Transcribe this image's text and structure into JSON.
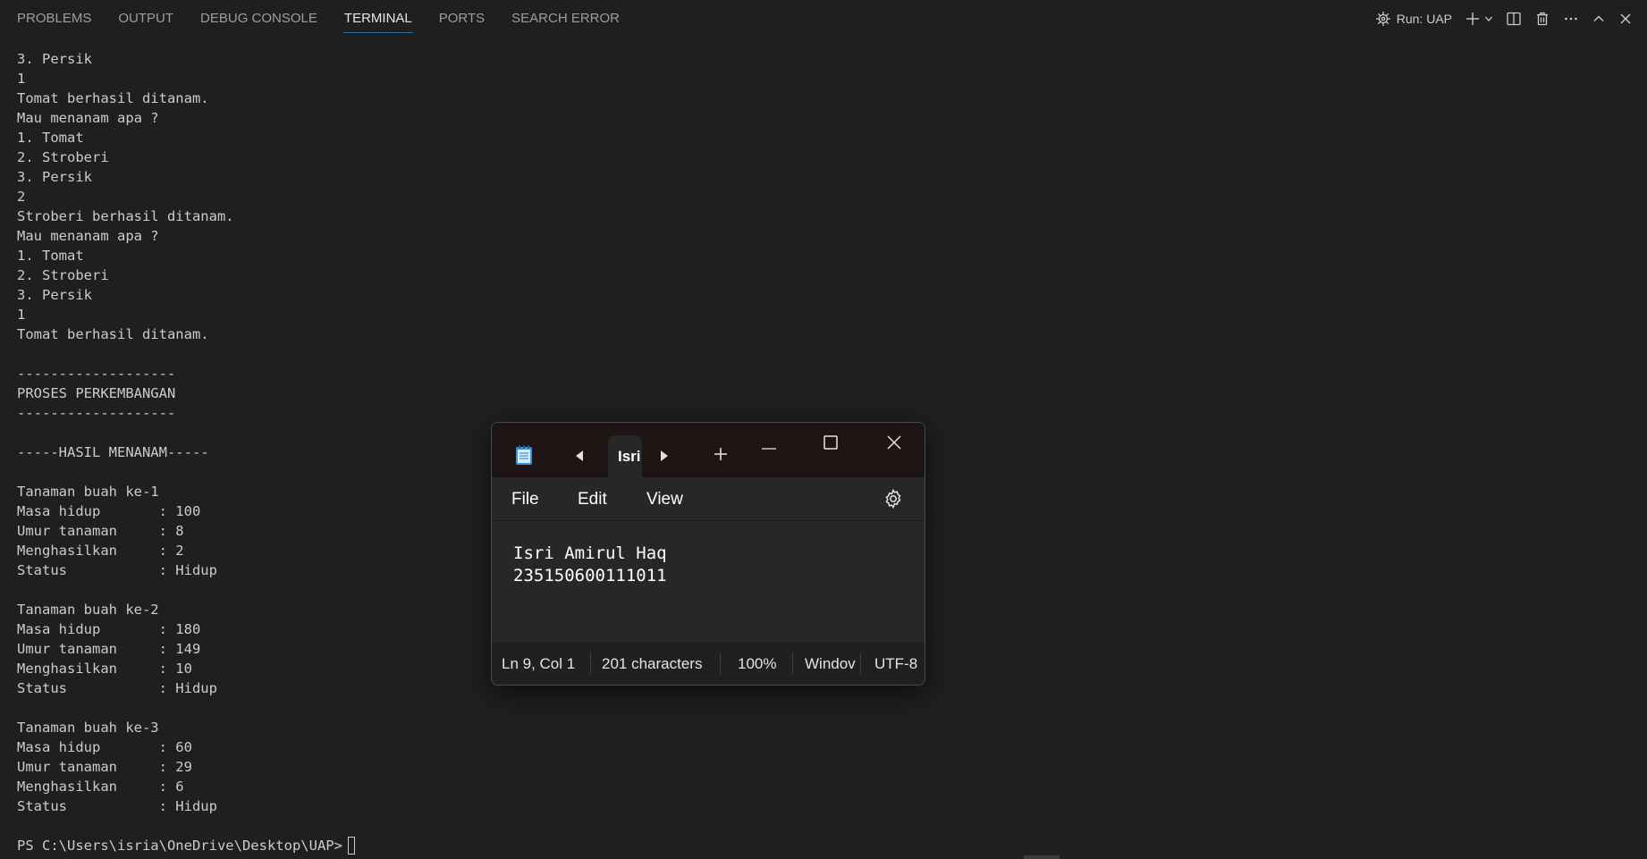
{
  "panel": {
    "tabs": [
      "PROBLEMS",
      "OUTPUT",
      "DEBUG CONSOLE",
      "TERMINAL",
      "PORTS",
      "SEARCH ERROR"
    ],
    "active_tab": "TERMINAL",
    "actions": {
      "run_label": "Run: UAP"
    },
    "accent_color": "#0078d4"
  },
  "terminal": {
    "lines": [
      "3. Persik",
      "1",
      "Tomat berhasil ditanam.",
      "Mau menanam apa ?",
      "1. Tomat",
      "2. Stroberi",
      "3. Persik",
      "2",
      "Stroberi berhasil ditanam.",
      "Mau menanam apa ?",
      "1. Tomat",
      "2. Stroberi",
      "3. Persik",
      "1",
      "Tomat berhasil ditanam.",
      "",
      "-------------------",
      "PROSES PERKEMBANGAN",
      "-------------------",
      "",
      "-----HASIL MENANAM-----",
      "",
      "Tanaman buah ke-1",
      "Masa hidup       : 100",
      "Umur tanaman     : 8",
      "Menghasilkan     : 2",
      "Status           : Hidup",
      "",
      "Tanaman buah ke-2",
      "Masa hidup       : 180",
      "Umur tanaman     : 149",
      "Menghasilkan     : 10",
      "Status           : Hidup",
      "",
      "Tanaman buah ke-3",
      "Masa hidup       : 60",
      "Umur tanaman     : 29",
      "Menghasilkan     : 6",
      "Status           : Hidup"
    ],
    "prompt": "PS C:\\Users\\isria\\OneDrive\\Desktop\\UAP>"
  },
  "notepad": {
    "tab_title": "Isri",
    "menu": {
      "file": "File",
      "edit": "Edit",
      "view": "View"
    },
    "content_lines": [
      "Isri Amirul Haq",
      "235150600111011"
    ],
    "status": {
      "position": "Ln 9, Col 1",
      "characters": "201 characters",
      "zoom": "100%",
      "line_ending": "Windov",
      "encoding": "UTF-8"
    }
  }
}
